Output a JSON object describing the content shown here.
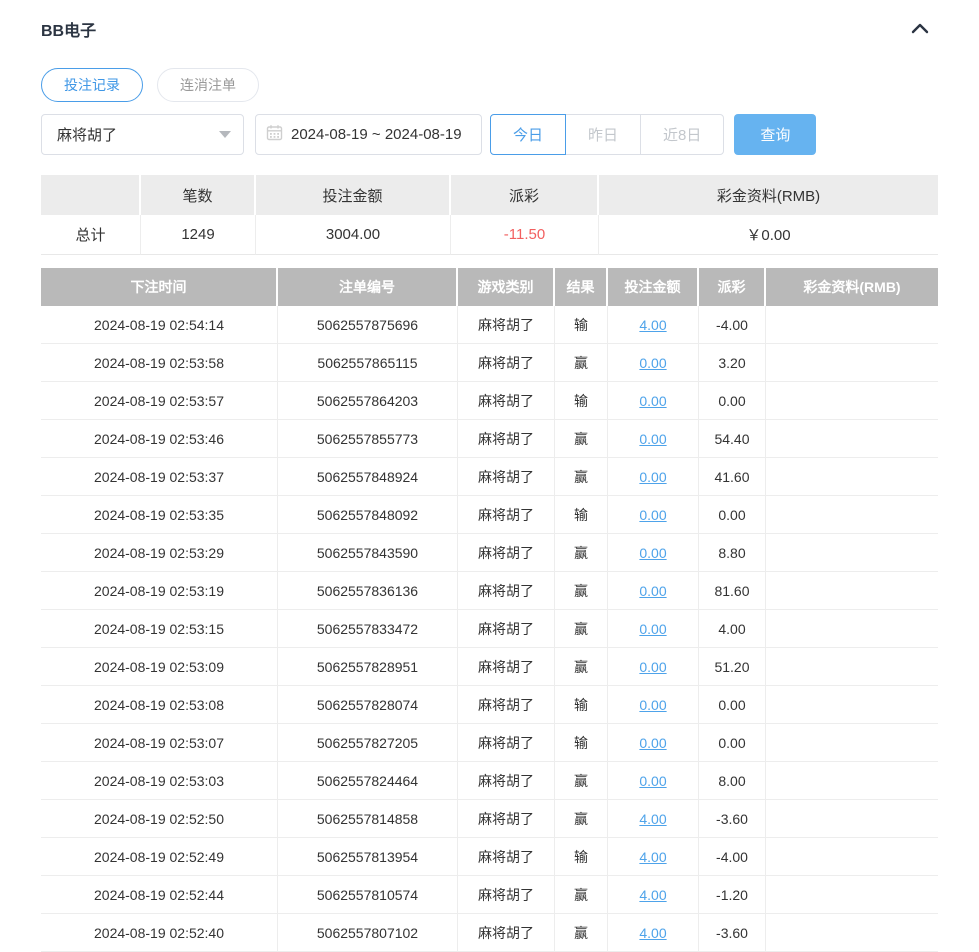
{
  "header": {
    "title": "BB电子"
  },
  "tabs": [
    {
      "label": "投注记录",
      "active": true
    },
    {
      "label": "连消注单",
      "active": false
    }
  ],
  "filters": {
    "game_select": {
      "value": "麻将胡了"
    },
    "date_range": "2024-08-19 ~ 2024-08-19",
    "quick_buttons": [
      {
        "label": "今日",
        "active": true
      },
      {
        "label": "昨日",
        "active": false
      },
      {
        "label": "近8日",
        "active": false
      }
    ],
    "search_label": "查询"
  },
  "summary": {
    "columns": [
      "",
      "笔数",
      "投注金额",
      "派彩",
      "彩金资料(RMB)"
    ],
    "row": {
      "label": "总计",
      "count": "1249",
      "bet_amount": "3004.00",
      "payout": "-11.50",
      "bonus": "￥0.00"
    }
  },
  "records": {
    "columns": [
      "下注时间",
      "注单编号",
      "游戏类别",
      "结果",
      "投注金额",
      "派彩",
      "彩金资料(RMB)"
    ],
    "rows": [
      {
        "time": "2024-08-19 02:54:14",
        "order_no": "5062557875696",
        "game": "麻将胡了",
        "result": "输",
        "bet": "4.00",
        "payout": "-4.00",
        "bonus": ""
      },
      {
        "time": "2024-08-19 02:53:58",
        "order_no": "5062557865115",
        "game": "麻将胡了",
        "result": "赢",
        "bet": "0.00",
        "payout": "3.20",
        "bonus": ""
      },
      {
        "time": "2024-08-19 02:53:57",
        "order_no": "5062557864203",
        "game": "麻将胡了",
        "result": "输",
        "bet": "0.00",
        "payout": "0.00",
        "bonus": ""
      },
      {
        "time": "2024-08-19 02:53:46",
        "order_no": "5062557855773",
        "game": "麻将胡了",
        "result": "赢",
        "bet": "0.00",
        "payout": "54.40",
        "bonus": ""
      },
      {
        "time": "2024-08-19 02:53:37",
        "order_no": "5062557848924",
        "game": "麻将胡了",
        "result": "赢",
        "bet": "0.00",
        "payout": "41.60",
        "bonus": ""
      },
      {
        "time": "2024-08-19 02:53:35",
        "order_no": "5062557848092",
        "game": "麻将胡了",
        "result": "输",
        "bet": "0.00",
        "payout": "0.00",
        "bonus": ""
      },
      {
        "time": "2024-08-19 02:53:29",
        "order_no": "5062557843590",
        "game": "麻将胡了",
        "result": "赢",
        "bet": "0.00",
        "payout": "8.80",
        "bonus": ""
      },
      {
        "time": "2024-08-19 02:53:19",
        "order_no": "5062557836136",
        "game": "麻将胡了",
        "result": "赢",
        "bet": "0.00",
        "payout": "81.60",
        "bonus": ""
      },
      {
        "time": "2024-08-19 02:53:15",
        "order_no": "5062557833472",
        "game": "麻将胡了",
        "result": "赢",
        "bet": "0.00",
        "payout": "4.00",
        "bonus": ""
      },
      {
        "time": "2024-08-19 02:53:09",
        "order_no": "5062557828951",
        "game": "麻将胡了",
        "result": "赢",
        "bet": "0.00",
        "payout": "51.20",
        "bonus": ""
      },
      {
        "time": "2024-08-19 02:53:08",
        "order_no": "5062557828074",
        "game": "麻将胡了",
        "result": "输",
        "bet": "0.00",
        "payout": "0.00",
        "bonus": ""
      },
      {
        "time": "2024-08-19 02:53:07",
        "order_no": "5062557827205",
        "game": "麻将胡了",
        "result": "输",
        "bet": "0.00",
        "payout": "0.00",
        "bonus": ""
      },
      {
        "time": "2024-08-19 02:53:03",
        "order_no": "5062557824464",
        "game": "麻将胡了",
        "result": "赢",
        "bet": "0.00",
        "payout": "8.00",
        "bonus": ""
      },
      {
        "time": "2024-08-19 02:52:50",
        "order_no": "5062557814858",
        "game": "麻将胡了",
        "result": "赢",
        "bet": "4.00",
        "payout": "-3.60",
        "bonus": ""
      },
      {
        "time": "2024-08-19 02:52:49",
        "order_no": "5062557813954",
        "game": "麻将胡了",
        "result": "输",
        "bet": "4.00",
        "payout": "-4.00",
        "bonus": ""
      },
      {
        "time": "2024-08-19 02:52:44",
        "order_no": "5062557810574",
        "game": "麻将胡了",
        "result": "赢",
        "bet": "4.00",
        "payout": "-1.20",
        "bonus": ""
      },
      {
        "time": "2024-08-19 02:52:40",
        "order_no": "5062557807102",
        "game": "麻将胡了",
        "result": "赢",
        "bet": "4.00",
        "payout": "-3.60",
        "bonus": ""
      }
    ]
  },
  "colors": {
    "accent_blue": "#4a9de8",
    "button_blue": "#66b3f0",
    "link_blue": "#4ea3ea",
    "negative_red": "#f25f5f",
    "table_header_grey": "#b9b9b9",
    "summary_header_grey": "#ececec"
  }
}
